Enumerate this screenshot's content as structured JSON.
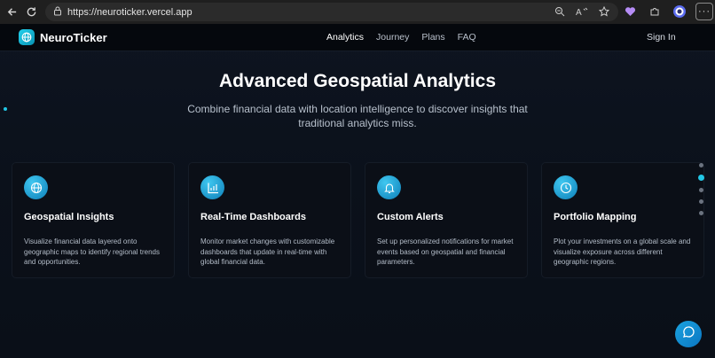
{
  "browser": {
    "url": "https://neuroticker.vercel.app",
    "icons": [
      "back-icon",
      "refresh-icon",
      "lock-icon",
      "zoom-icon",
      "read-aloud-icon",
      "favorite-icon",
      "extension-icon",
      "profile-icon",
      "more-icon"
    ],
    "more_label": "···"
  },
  "site": {
    "brand": "NeuroTicker",
    "nav": [
      {
        "label": "Analytics",
        "active": true
      },
      {
        "label": "Journey",
        "active": false
      },
      {
        "label": "Plans",
        "active": false
      },
      {
        "label": "FAQ",
        "active": false
      }
    ],
    "signin": "Sign In"
  },
  "hero": {
    "title": "Advanced Geospatial Analytics",
    "subtitle": "Combine financial data with location intelligence to discover insights that traditional analytics miss."
  },
  "cards": [
    {
      "icon": "globe-icon",
      "title": "Geospatial Insights",
      "desc": "Visualize financial data layered onto geographic maps to identify regional trends and opportunities."
    },
    {
      "icon": "chart-icon",
      "title": "Real-Time Dashboards",
      "desc": "Monitor market changes with customizable dashboards that update in real-time with global financial data."
    },
    {
      "icon": "bell-icon",
      "title": "Custom Alerts",
      "desc": "Set up personalized notifications for market events based on geospatial and financial parameters."
    },
    {
      "icon": "clock-icon",
      "title": "Portfolio Mapping",
      "desc": "Plot your investments on a global scale and visualize exposure across different geographic regions."
    }
  ],
  "pager": {
    "count": 5,
    "active_index": 1
  },
  "colors": {
    "accent": "#22c7e6",
    "background": "#0b0f16",
    "card": "#0b0f17"
  }
}
